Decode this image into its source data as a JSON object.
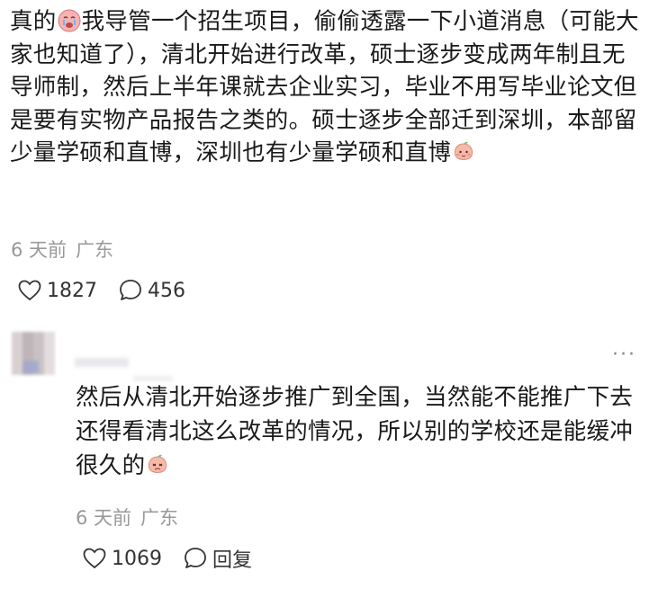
{
  "post": {
    "text_part1": "真的",
    "text_part2": "我导管一个招生项目，偷偷透露一下小道消息（可能大家也知道了），清北开始进行改革，硕士逐步变成两年制且无导师制，然后上半年课就去企业实习，毕业不用写毕业论文但是要有实物产品报告之类的。硕士逐步全部迁到深圳，本部留少量学硕和直博，深圳也有少量学硕和直博",
    "emoji1": "crying-face-emoji",
    "emoji2": "peach-face-emoji",
    "time": "6 天前",
    "location": "广东",
    "likes": "1827",
    "comments": "456"
  },
  "reply": {
    "text": "然后从清北开始逐步推广到全国，当然能不能推广下去还得看清北这么改革的情况，所以别的学校还是能缓冲很久的",
    "emoji": "peach-face-emoji",
    "time": "6 天前",
    "location": "广东",
    "likes": "1069",
    "reply_label": "回复",
    "more": "···"
  },
  "colors": {
    "text": "#1a1a1a",
    "meta": "#999999",
    "emoji_peach": "#f4a6a6"
  }
}
